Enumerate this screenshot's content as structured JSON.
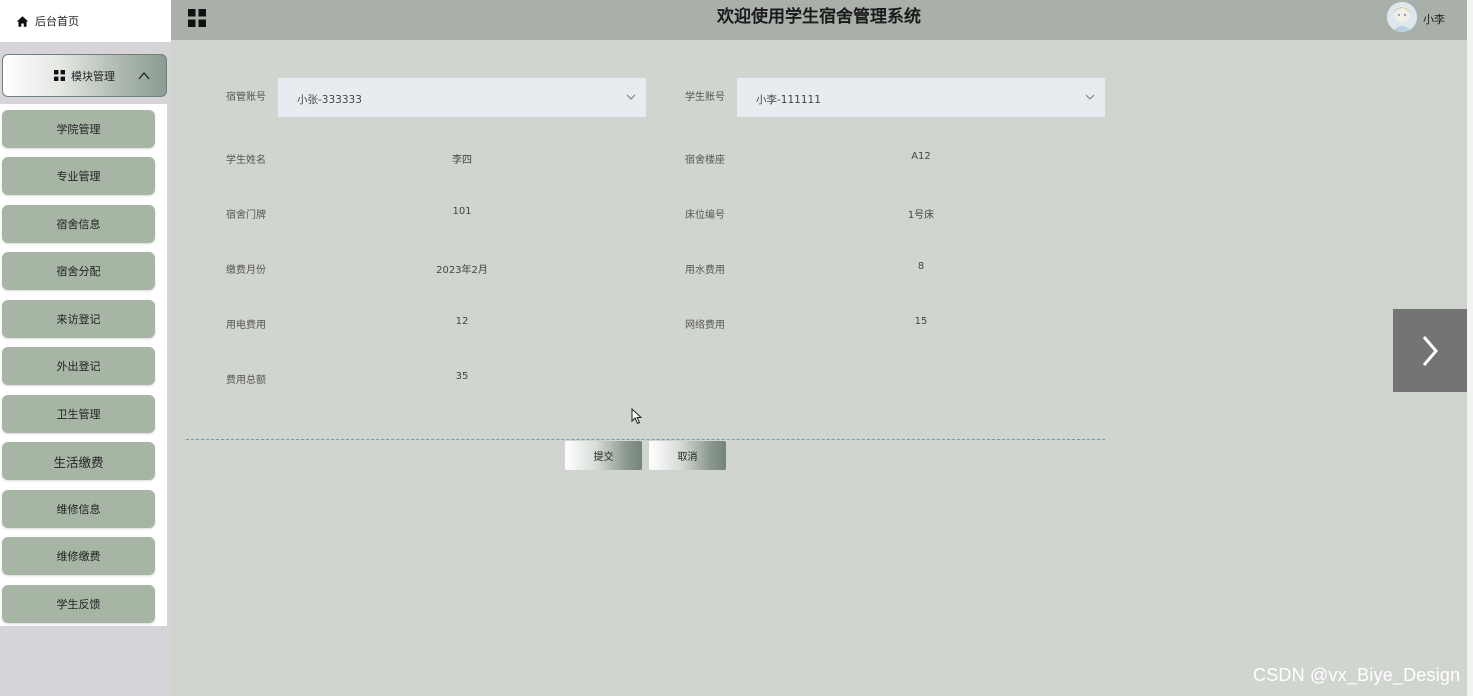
{
  "header": {
    "title": "欢迎使用学生宿舍管理系统",
    "username": "小李"
  },
  "sidebar": {
    "home": "后台首页",
    "module": "模块管理",
    "items": [
      {
        "label": "学院管理"
      },
      {
        "label": "专业管理"
      },
      {
        "label": "宿舍信息"
      },
      {
        "label": "宿舍分配"
      },
      {
        "label": "来访登记"
      },
      {
        "label": "外出登记"
      },
      {
        "label": "卫生管理"
      },
      {
        "label": "生活缴费"
      },
      {
        "label": "维修信息"
      },
      {
        "label": "维修缴费"
      },
      {
        "label": "学生反馈"
      }
    ]
  },
  "form": {
    "manager_account": {
      "label": "宿管账号",
      "value": "小张-333333"
    },
    "student_account": {
      "label": "学生账号",
      "value": "小李-111111"
    },
    "student_name": {
      "label": "学生姓名",
      "value": "李四"
    },
    "building": {
      "label": "宿舍楼座",
      "value": "A12"
    },
    "room": {
      "label": "宿舍门牌",
      "value": "101"
    },
    "bed": {
      "label": "床位编号",
      "value": "1号床"
    },
    "month": {
      "label": "缴费月份",
      "value": "2023年2月"
    },
    "water_fee": {
      "label": "用水费用",
      "value": "8"
    },
    "electric_fee": {
      "label": "用电费用",
      "value": "12"
    },
    "network_fee": {
      "label": "网络费用",
      "value": "15"
    },
    "total_fee": {
      "label": "费用总额",
      "value": "35"
    },
    "submit": "提交",
    "cancel": "取消"
  },
  "watermark": "CSDN @vx_Biye_Design",
  "colors": {
    "menu_item": "#a6b5a4",
    "header": "#a9b0a9",
    "content_bg": "#d1d5d0"
  }
}
